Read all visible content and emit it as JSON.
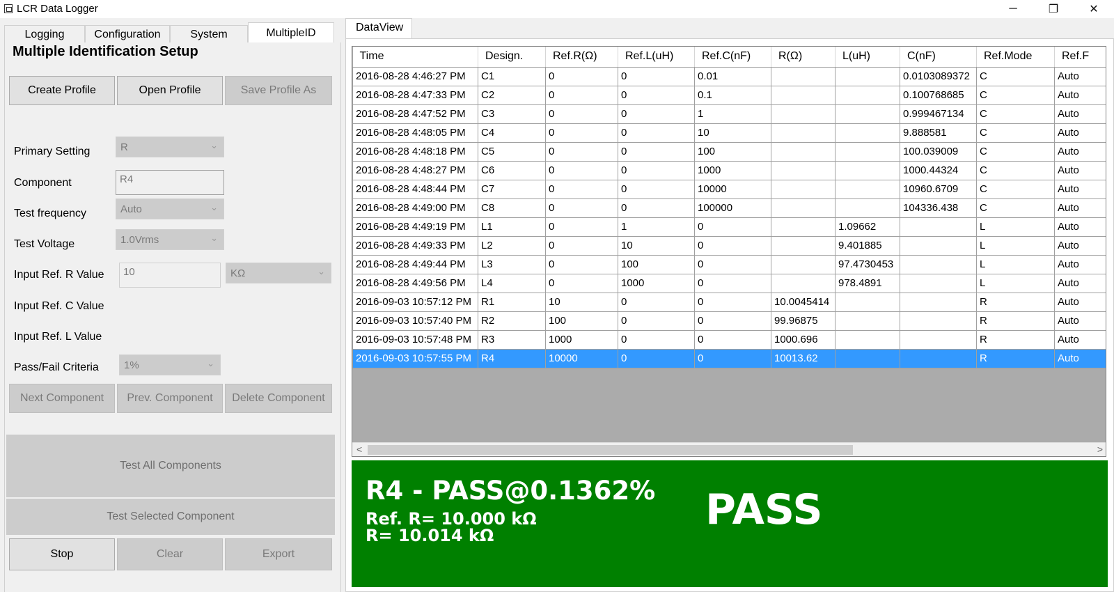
{
  "window": {
    "title": "LCR Data Logger",
    "minimize": "─",
    "restore": "❐",
    "close": "✕"
  },
  "tabs": [
    {
      "label": "Logging"
    },
    {
      "label": "Configuration"
    },
    {
      "label": "System"
    },
    {
      "label": "MultipleID"
    }
  ],
  "setup": {
    "title": "Multiple Identification  Setup",
    "create_profile": "Create Profile",
    "open_profile": "Open Profile",
    "save_profile_as": "Save Profile As",
    "primary_setting_label": "Primary Setting",
    "primary_setting_value": "R",
    "component_label": "Component",
    "component_value": "R4",
    "test_frequency_label": "Test frequency",
    "test_frequency_value": "Auto",
    "test_voltage_label": "Test Voltage",
    "test_voltage_value": "1.0Vrms",
    "input_ref_r_label": "Input Ref. R Value",
    "input_ref_r_value": "10",
    "input_ref_r_unit": "KΩ",
    "input_ref_c_label": "Input Ref. C Value",
    "input_ref_l_label": "Input Ref. L Value",
    "pass_fail_label": "Pass/Fail Criteria",
    "pass_fail_value": "1%",
    "next_component": "Next Component",
    "prev_component": "Prev. Component",
    "delete_component": "Delete Component",
    "test_all": "Test All Components",
    "test_selected": "Test Selected Component",
    "stop": "Stop",
    "clear": "Clear",
    "export": "Export"
  },
  "dataview": {
    "tab_label": "DataView",
    "columns": [
      "Time",
      "Design.",
      "Ref.R(Ω)",
      "Ref.L(uH)",
      "Ref.C(nF)",
      "R(Ω)",
      "L(uH)",
      "C(nF)",
      "Ref.Mode",
      "Ref.F"
    ],
    "rows": [
      [
        "2016-08-28 4:46:27 PM",
        "C1",
        "0",
        "0",
        "0.01",
        "",
        "",
        "0.0103089372",
        "C",
        "Auto"
      ],
      [
        "2016-08-28 4:47:33 PM",
        "C2",
        "0",
        "0",
        "0.1",
        "",
        "",
        "0.100768685",
        "C",
        "Auto"
      ],
      [
        "2016-08-28 4:47:52 PM",
        "C3",
        "0",
        "0",
        "1",
        "",
        "",
        "0.999467134",
        "C",
        "Auto"
      ],
      [
        "2016-08-28 4:48:05 PM",
        "C4",
        "0",
        "0",
        "10",
        "",
        "",
        "9.888581",
        "C",
        "Auto"
      ],
      [
        "2016-08-28 4:48:18 PM",
        "C5",
        "0",
        "0",
        "100",
        "",
        "",
        "100.039009",
        "C",
        "Auto"
      ],
      [
        "2016-08-28 4:48:27 PM",
        "C6",
        "0",
        "0",
        "1000",
        "",
        "",
        "1000.44324",
        "C",
        "Auto"
      ],
      [
        "2016-08-28 4:48:44 PM",
        "C7",
        "0",
        "0",
        "10000",
        "",
        "",
        "10960.6709",
        "C",
        "Auto"
      ],
      [
        "2016-08-28 4:49:00 PM",
        "C8",
        "0",
        "0",
        "100000",
        "",
        "",
        "104336.438",
        "C",
        "Auto"
      ],
      [
        "2016-08-28 4:49:19 PM",
        "L1",
        "0",
        "1",
        "0",
        "",
        "1.09662",
        "",
        "L",
        "Auto"
      ],
      [
        "2016-08-28 4:49:33 PM",
        "L2",
        "0",
        "10",
        "0",
        "",
        "9.401885",
        "",
        "L",
        "Auto"
      ],
      [
        "2016-08-28 4:49:44 PM",
        "L3",
        "0",
        "100",
        "0",
        "",
        "97.4730453",
        "",
        "L",
        "Auto"
      ],
      [
        "2016-08-28 4:49:56 PM",
        "L4",
        "0",
        "1000",
        "0",
        "",
        "978.4891",
        "",
        "L",
        "Auto"
      ],
      [
        "2016-09-03 10:57:12 PM",
        "R1",
        "10",
        "0",
        "0",
        "10.0045414",
        "",
        "",
        "R",
        "Auto"
      ],
      [
        "2016-09-03 10:57:40 PM",
        "R2",
        "100",
        "0",
        "0",
        "99.96875",
        "",
        "",
        "R",
        "Auto"
      ],
      [
        "2016-09-03 10:57:48 PM",
        "R3",
        "1000",
        "0",
        "0",
        "1000.696",
        "",
        "",
        "R",
        "Auto"
      ],
      [
        "2016-09-03 10:57:55 PM",
        "R4",
        "10000",
        "0",
        "0",
        "10013.62",
        "",
        "",
        "R",
        "Auto"
      ]
    ],
    "selected_row": 15,
    "scroll_left": "<",
    "scroll_right": ">"
  },
  "result": {
    "headline": "R4 - PASS@0.1362%",
    "ref_line": "Ref. R= 10.000 kΩ",
    "meas_line": "R= 10.014 kΩ",
    "status": "PASS",
    "color": "#008000"
  }
}
